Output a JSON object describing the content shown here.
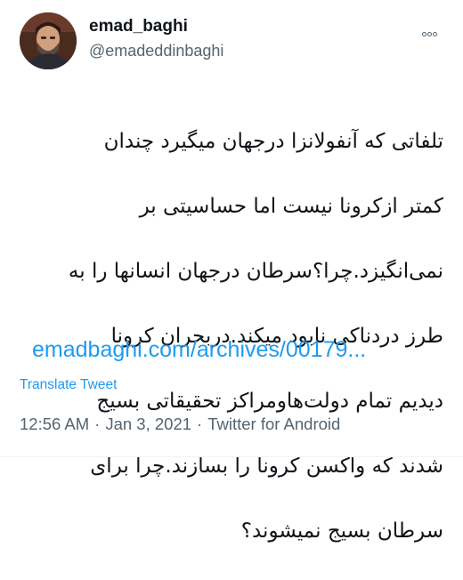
{
  "user": {
    "display_name": "emad_baghi",
    "handle": "@emadeddinbaghi"
  },
  "icons": {
    "more": "more-options-icon"
  },
  "tweet": {
    "lines": [
      "تلفاتی که آنفولانزا درجهان میگیرد چندان",
      "کمتر ازکرونا نیست اما حساسیتی بر",
      "نمی‌انگیزد.چرا؟سرطان درجهان انسانها را به",
      "طرز دردناکی نابود میکند.دربحران کرونا",
      "دیدیم تمام دولت‌هاومراکز تحقیقاتی بسیج",
      "شدند که واکسن کرونا را بسازند.چرا برای",
      "سرطان بسیج نمیشوند؟"
    ],
    "link": "emadbaghi.com/archives/00179...",
    "translate_label": "Translate Tweet"
  },
  "meta": {
    "time": "12:56 AM",
    "separator": "·",
    "date": "Jan 3, 2021",
    "source": "Twitter for Android"
  },
  "colors": {
    "link": "#1d9bf0",
    "secondary_text": "#536471",
    "primary_text": "#0f1419"
  }
}
